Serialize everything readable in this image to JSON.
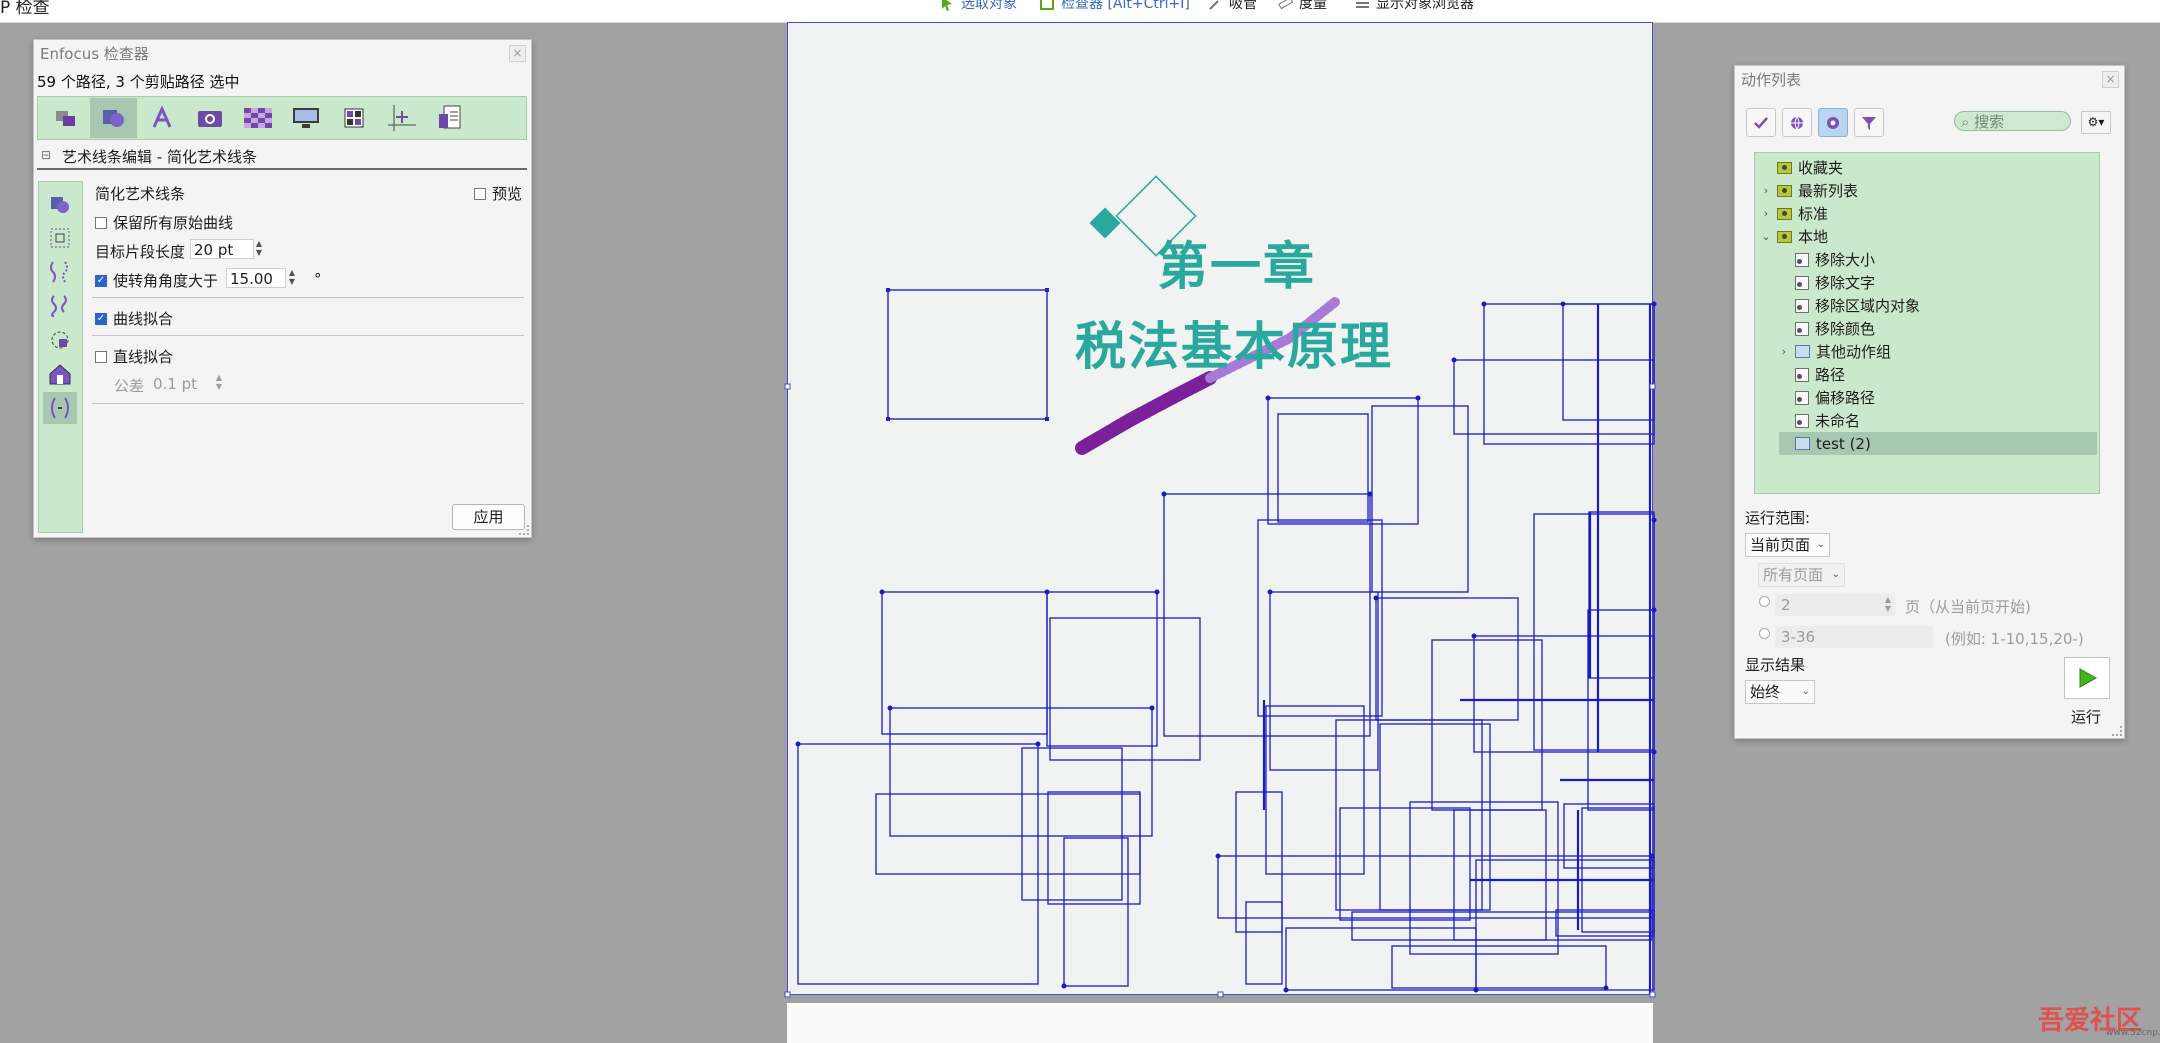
{
  "app": {
    "title_fragment": "P 检查"
  },
  "toolbar": {
    "items": [
      {
        "label": "选取对象",
        "icon": "select-arrow-icon"
      },
      {
        "label": "检查器 [Alt+Ctrl+I]",
        "icon": "inspector-icon"
      },
      {
        "label": "吸管",
        "icon": "eyedropper-icon"
      },
      {
        "label": "度量",
        "icon": "ruler-icon"
      },
      {
        "label": "显示对象浏览器",
        "icon": "list-icon"
      }
    ]
  },
  "document": {
    "chapter": "第一章",
    "subtitle": "税法基本原理",
    "colors": {
      "text": "#29a89e",
      "paths": "#1b1bc4",
      "scribble": "#7c1f9a"
    }
  },
  "inspector": {
    "title": "Enfocus 检查器",
    "status": "59 个路径, 3 个剪贴路径 选中",
    "section_label": "艺术线条编辑 - 简化艺术线条",
    "tabs": [
      "objects-icon",
      "shapes-icon",
      "text-icon",
      "image-icon",
      "transparency-icon",
      "display-icon",
      "layout-icon",
      "position-icon",
      "document-icon"
    ],
    "side_tools": [
      "shapes-icon",
      "bounds-icon",
      "curve-icon",
      "wave-icon",
      "rotate-icon",
      "home-icon",
      "simplify-icon"
    ],
    "heading": "简化艺术线条",
    "preview_label": "预览",
    "keep_original_label": "保留所有原始曲线",
    "target_length_label": "目标片段长度",
    "target_length_value": "20 pt",
    "angle_label": "使转角角度大于",
    "angle_value": "15.00",
    "angle_unit": "°",
    "curve_fit_label": "曲线拟合",
    "line_fit_label": "直线拟合",
    "tolerance_label": "公差",
    "tolerance_value": "0.1 pt",
    "apply_label": "应用",
    "checks": {
      "preview": false,
      "keep_original": false,
      "angle": true,
      "curve_fit": true,
      "line_fit": false
    }
  },
  "actions": {
    "title": "动作列表",
    "search_placeholder": "搜索",
    "toolbar_icons": [
      "check-icon",
      "globe-icon",
      "gear-icon",
      "filter-icon"
    ],
    "tree": [
      {
        "label": "收藏夹",
        "level": 0,
        "type": "folder",
        "caret": ""
      },
      {
        "label": "最新列表",
        "level": 0,
        "type": "folder",
        "caret": "›"
      },
      {
        "label": "标准",
        "level": 0,
        "type": "folder",
        "caret": "›"
      },
      {
        "label": "本地",
        "level": 0,
        "type": "folder",
        "caret": "⌄"
      },
      {
        "label": "移除大小",
        "level": 1,
        "type": "action",
        "caret": ""
      },
      {
        "label": "移除文字",
        "level": 1,
        "type": "action",
        "caret": ""
      },
      {
        "label": "移除区域内对象",
        "level": 1,
        "type": "action",
        "caret": ""
      },
      {
        "label": "移除颜色",
        "level": 1,
        "type": "action",
        "caret": ""
      },
      {
        "label": "其他动作组",
        "level": 1,
        "type": "group",
        "caret": "›"
      },
      {
        "label": "路径",
        "level": 1,
        "type": "action",
        "caret": ""
      },
      {
        "label": "偏移路径",
        "level": 1,
        "type": "action",
        "caret": ""
      },
      {
        "label": "未命名",
        "level": 1,
        "type": "action",
        "caret": ""
      },
      {
        "label": "test (2)",
        "level": 1,
        "type": "group",
        "caret": "",
        "selected": true
      }
    ],
    "range_label": "运行范围:",
    "range_value": "当前页面",
    "all_pages_value": "所有页面",
    "page_number": "2",
    "page_suffix": "页（从当前页开始)",
    "page_range": "3-36",
    "page_range_example": "(例如: 1-10,15,20-)",
    "show_results_label": "显示结果",
    "show_results_value": "始终",
    "run_label": "运行"
  },
  "watermark": {
    "text": "吾爱社区",
    "url": "www.52cnp.com"
  }
}
